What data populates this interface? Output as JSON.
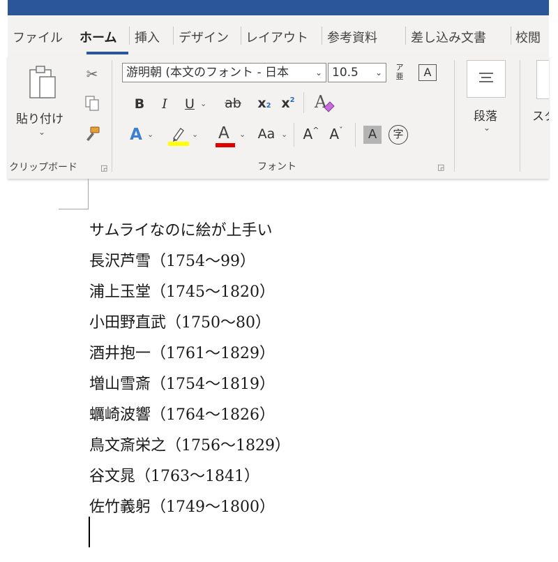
{
  "tabs": [
    {
      "label": "ファイル"
    },
    {
      "label": "ホーム"
    },
    {
      "label": "挿入"
    },
    {
      "label": "デザイン"
    },
    {
      "label": "レイアウト"
    },
    {
      "label": "参考資料"
    },
    {
      "label": "差し込み文書"
    },
    {
      "label": "校閲"
    }
  ],
  "clipboard": {
    "paste_label": "貼り付け",
    "group_label": "クリップボード"
  },
  "font": {
    "font_name": "游明朝 (本文のフォント - 日本",
    "font_size": "10.5",
    "bold": "B",
    "italic": "I",
    "underline": "U",
    "strikethrough": "ab",
    "subscript": "x",
    "subscript_mark": "2",
    "superscript": "x",
    "superscript_mark": "2",
    "text_effects": "A",
    "font_color": "A",
    "change_case": "Aa",
    "grow_font": "A",
    "shrink_font": "A",
    "shading": "A",
    "enclose": "字",
    "group_label": "フォント",
    "highlight_color": "#ffff00",
    "font_color_value": "#e00000"
  },
  "paragraph": {
    "label": "段落"
  },
  "styles": {
    "label": "スタ"
  },
  "document": {
    "lines": [
      "サムライなのに絵が上手い",
      "長沢芦雪（1754～99）",
      "浦上玉堂（1745～1820）",
      "小田野直武（1750～80）",
      "酒井抱一（1761～1829）",
      "増山雪斎（1754～1819）",
      "蠣崎波響（1764～1826）",
      "鳥文斎栄之（1756～1829）",
      "谷文晁（1763～1841）",
      "佐竹義躬（1749～1800）"
    ]
  }
}
